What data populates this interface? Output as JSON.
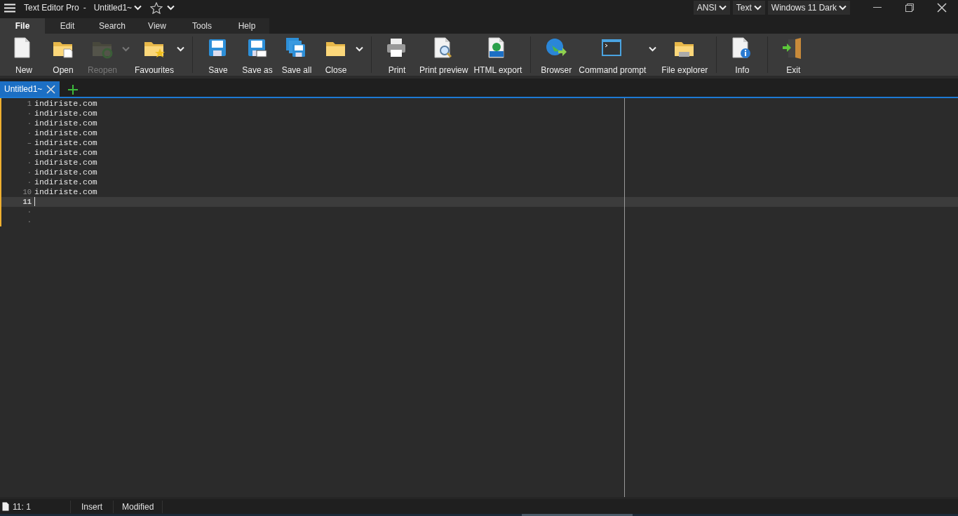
{
  "window": {
    "app_name": "Text Editor Pro",
    "separator": "-",
    "document": "Untitled1~"
  },
  "selectors": [
    {
      "label": "ANSI"
    },
    {
      "label": "Text"
    },
    {
      "label": "Windows 11 Dark"
    }
  ],
  "menu_tabs": [
    {
      "label": "File",
      "selected": true
    },
    {
      "label": "Edit",
      "selected": false
    },
    {
      "label": "Search",
      "selected": false
    },
    {
      "label": "View",
      "selected": false
    },
    {
      "label": "Tools",
      "selected": false
    },
    {
      "label": "Help",
      "selected": false
    }
  ],
  "ribbon": [
    {
      "kind": "button",
      "label": "New",
      "disabled": false,
      "dropdown": false
    },
    {
      "kind": "button",
      "label": "Open",
      "disabled": false,
      "dropdown": false
    },
    {
      "kind": "button",
      "label": "Reopen",
      "disabled": true,
      "dropdown": true
    },
    {
      "kind": "button",
      "label": "Favourites",
      "disabled": false,
      "dropdown": true
    },
    {
      "kind": "separator"
    },
    {
      "kind": "button",
      "label": "Save",
      "disabled": false,
      "dropdown": false
    },
    {
      "kind": "button",
      "label": "Save as",
      "disabled": false,
      "dropdown": false
    },
    {
      "kind": "button",
      "label": "Save all",
      "disabled": false,
      "dropdown": false
    },
    {
      "kind": "button",
      "label": "Close",
      "disabled": false,
      "dropdown": true
    },
    {
      "kind": "separator"
    },
    {
      "kind": "button",
      "label": "Print",
      "disabled": false,
      "dropdown": false
    },
    {
      "kind": "button",
      "label": "Print preview",
      "disabled": false,
      "dropdown": false
    },
    {
      "kind": "button",
      "label": "HTML export",
      "disabled": false,
      "dropdown": false
    },
    {
      "kind": "separator"
    },
    {
      "kind": "button",
      "label": "Browser",
      "disabled": false,
      "dropdown": false
    },
    {
      "kind": "button",
      "label": "Command prompt",
      "disabled": false,
      "dropdown": true
    },
    {
      "kind": "button",
      "label": "File explorer",
      "disabled": false,
      "dropdown": false
    },
    {
      "kind": "separator"
    },
    {
      "kind": "button",
      "label": "Info",
      "disabled": false,
      "dropdown": false
    },
    {
      "kind": "separator"
    },
    {
      "kind": "button",
      "label": "Exit",
      "disabled": false,
      "dropdown": false
    }
  ],
  "doc_tabs": [
    {
      "label": "Untitled1~",
      "selected": true
    }
  ],
  "editor": {
    "lines": [
      {
        "gutter": "1",
        "text": "indiriste.com",
        "current": false
      },
      {
        "gutter": "·",
        "text": "indiriste.com",
        "current": false
      },
      {
        "gutter": "·",
        "text": "indiriste.com",
        "current": false
      },
      {
        "gutter": "·",
        "text": "indiriste.com",
        "current": false
      },
      {
        "gutter": "–",
        "text": "indiriste.com",
        "current": false
      },
      {
        "gutter": "·",
        "text": "indiriste.com",
        "current": false
      },
      {
        "gutter": "·",
        "text": "indiriste.com",
        "current": false
      },
      {
        "gutter": "·",
        "text": "indiriste.com",
        "current": false
      },
      {
        "gutter": "·",
        "text": "indiriste.com",
        "current": false
      },
      {
        "gutter": "10",
        "text": "indiriste.com",
        "current": false
      },
      {
        "gutter": "11",
        "current": true
      },
      {
        "gutter": "·",
        "current": false
      },
      {
        "gutter": "·",
        "current": false
      }
    ]
  },
  "status_bar": {
    "position": "11: 1",
    "mode": "Insert",
    "state": "Modified"
  }
}
